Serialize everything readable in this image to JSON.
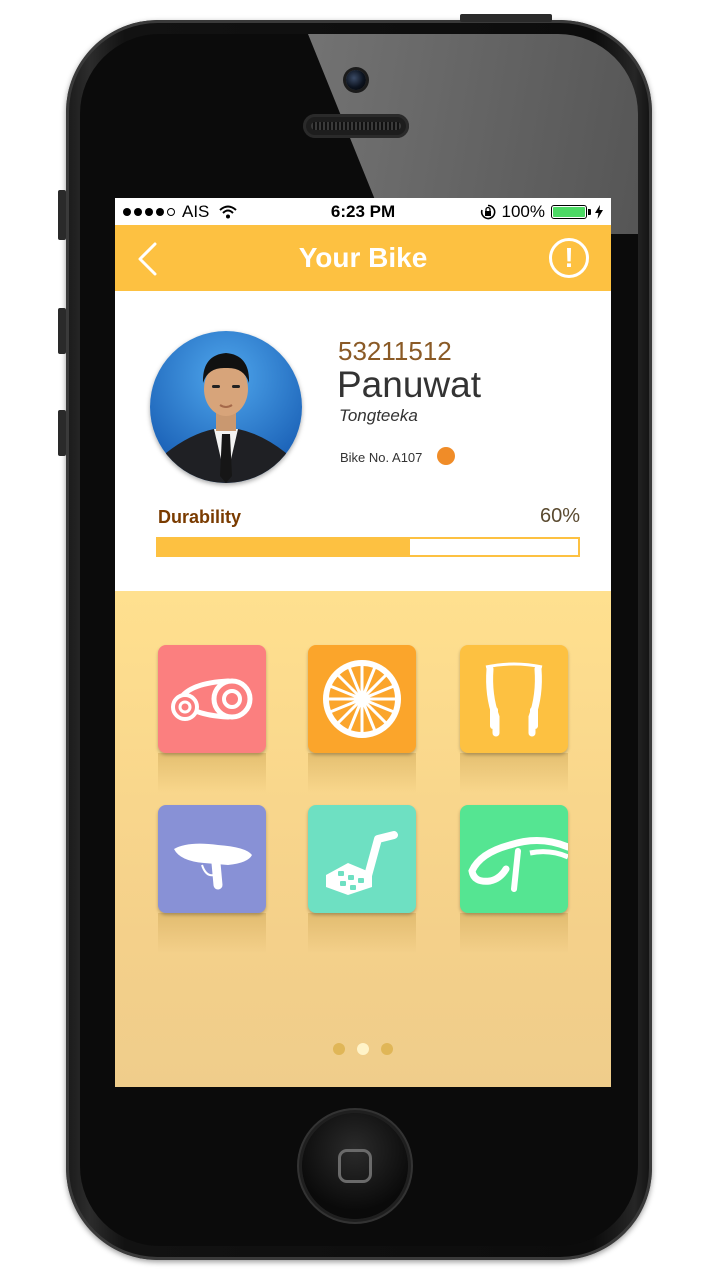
{
  "status_bar": {
    "signal_dots": 5,
    "carrier": "AIS",
    "time": "6:23 PM",
    "battery_percent": "100%",
    "battery_level": 1.0
  },
  "nav": {
    "title": "Your Bike",
    "back_icon": "chevron-left-icon",
    "alert_icon": "exclamation-circle-icon",
    "alert_symbol": "!"
  },
  "profile": {
    "student_id": "53211512",
    "first_name": "Panuwat",
    "last_name": "Tongteeka",
    "bike_no": "Bike No. A107",
    "bike_status_color": "#f08c28"
  },
  "durability": {
    "label": "Durability",
    "value_text": "60%",
    "fraction": 0.6
  },
  "parts": [
    {
      "name": "chain",
      "icon": "chain-gear-icon",
      "color": "#fb7f7f"
    },
    {
      "name": "wheel",
      "icon": "wheel-icon",
      "color": "#fba52b"
    },
    {
      "name": "brakes",
      "icon": "brake-icon",
      "color": "#fdc141"
    },
    {
      "name": "seat",
      "icon": "bike-seat-icon",
      "color": "#8891d6"
    },
    {
      "name": "pedal",
      "icon": "pedal-icon",
      "color": "#6ee0c2"
    },
    {
      "name": "handlebar",
      "icon": "handlebar-icon",
      "color": "#55e592"
    }
  ],
  "pager": {
    "count": 3,
    "active_index": 1
  },
  "colors": {
    "accent": "#fdc141",
    "brown": "#7a3b00"
  }
}
